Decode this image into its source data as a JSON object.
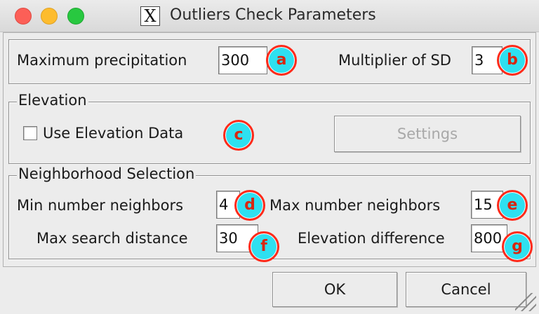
{
  "window": {
    "title": "Outliers Check Parameters",
    "icon": "x-window-icon"
  },
  "top_row": {
    "max_precip_label": "Maximum precipitation",
    "max_precip_value": "300",
    "multiplier_label": "Multiplier of SD",
    "multiplier_value": "3"
  },
  "elevation": {
    "legend": "Elevation",
    "use_elevation_label": "Use Elevation Data",
    "use_elevation_checked": false,
    "settings_label": "Settings"
  },
  "neighborhood": {
    "legend": "Neighborhood Selection",
    "min_neighbors_label": "Min number neighbors",
    "min_neighbors_value": "4",
    "max_neighbors_label": "Max number neighbors",
    "max_neighbors_value": "15",
    "max_search_label": "Max search distance",
    "max_search_value": "30",
    "elev_diff_label": "Elevation difference",
    "elev_diff_value": "800"
  },
  "buttons": {
    "ok": "OK",
    "cancel": "Cancel"
  },
  "badges": {
    "a": "a",
    "b": "b",
    "c": "c",
    "d": "d",
    "e": "e",
    "f": "f",
    "g": "g"
  },
  "colors": {
    "badge_fill": "#2ee0f0",
    "badge_ring": "#ff2a1a",
    "badge_text": "#d8260f"
  }
}
